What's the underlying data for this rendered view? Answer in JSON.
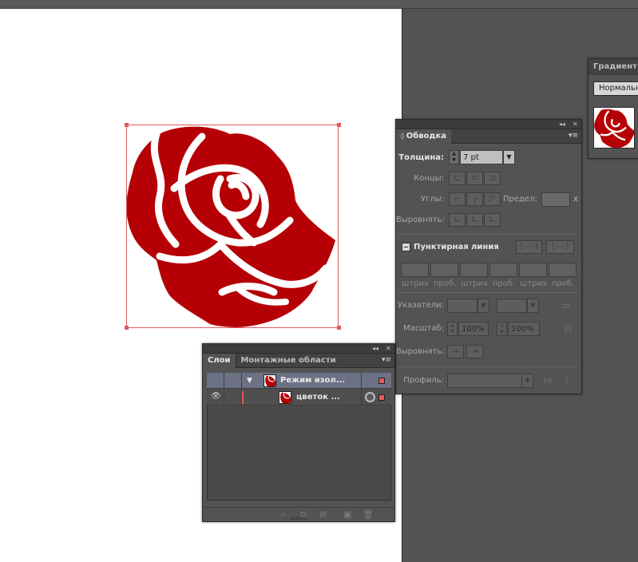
{
  "canvas": {
    "artwork": "rose-illustration",
    "colors": {
      "rose": "#b50005",
      "selection": "#e05a5a",
      "artboard": "#ffffff",
      "pasteboard": "#535353"
    }
  },
  "gradient_panel": {
    "tab": "Градиент",
    "type_select": "Нормальна"
  },
  "stroke_panel": {
    "tab": "Обводка",
    "weight_label": "Толщина:",
    "weight_value": "7 pt",
    "cap_label": "Концы:",
    "corner_label": "Углы:",
    "limit_label": "Предел:",
    "limit_suffix": "x",
    "align_label": "Выровнять:",
    "dashed_label": "Пунктирная линия",
    "dash_labels": [
      "штрих",
      "проб.",
      "штрих",
      "проб.",
      "штрих",
      "проб."
    ],
    "arrowheads_label": "Указатели:",
    "scale_label": "Масштаб:",
    "scale_start": "100%",
    "scale_end": "100%",
    "align_arrows_label": "Выровнять:",
    "profile_label": "Профиль:"
  },
  "layers_panel": {
    "tabs": [
      "Слои",
      "Монтажные области"
    ],
    "rows": [
      {
        "name": "Режим изол...",
        "type": "isolation-group"
      },
      {
        "name": "цветок ...",
        "type": "sublayer"
      }
    ],
    "accent_color": "#e55a5a"
  }
}
